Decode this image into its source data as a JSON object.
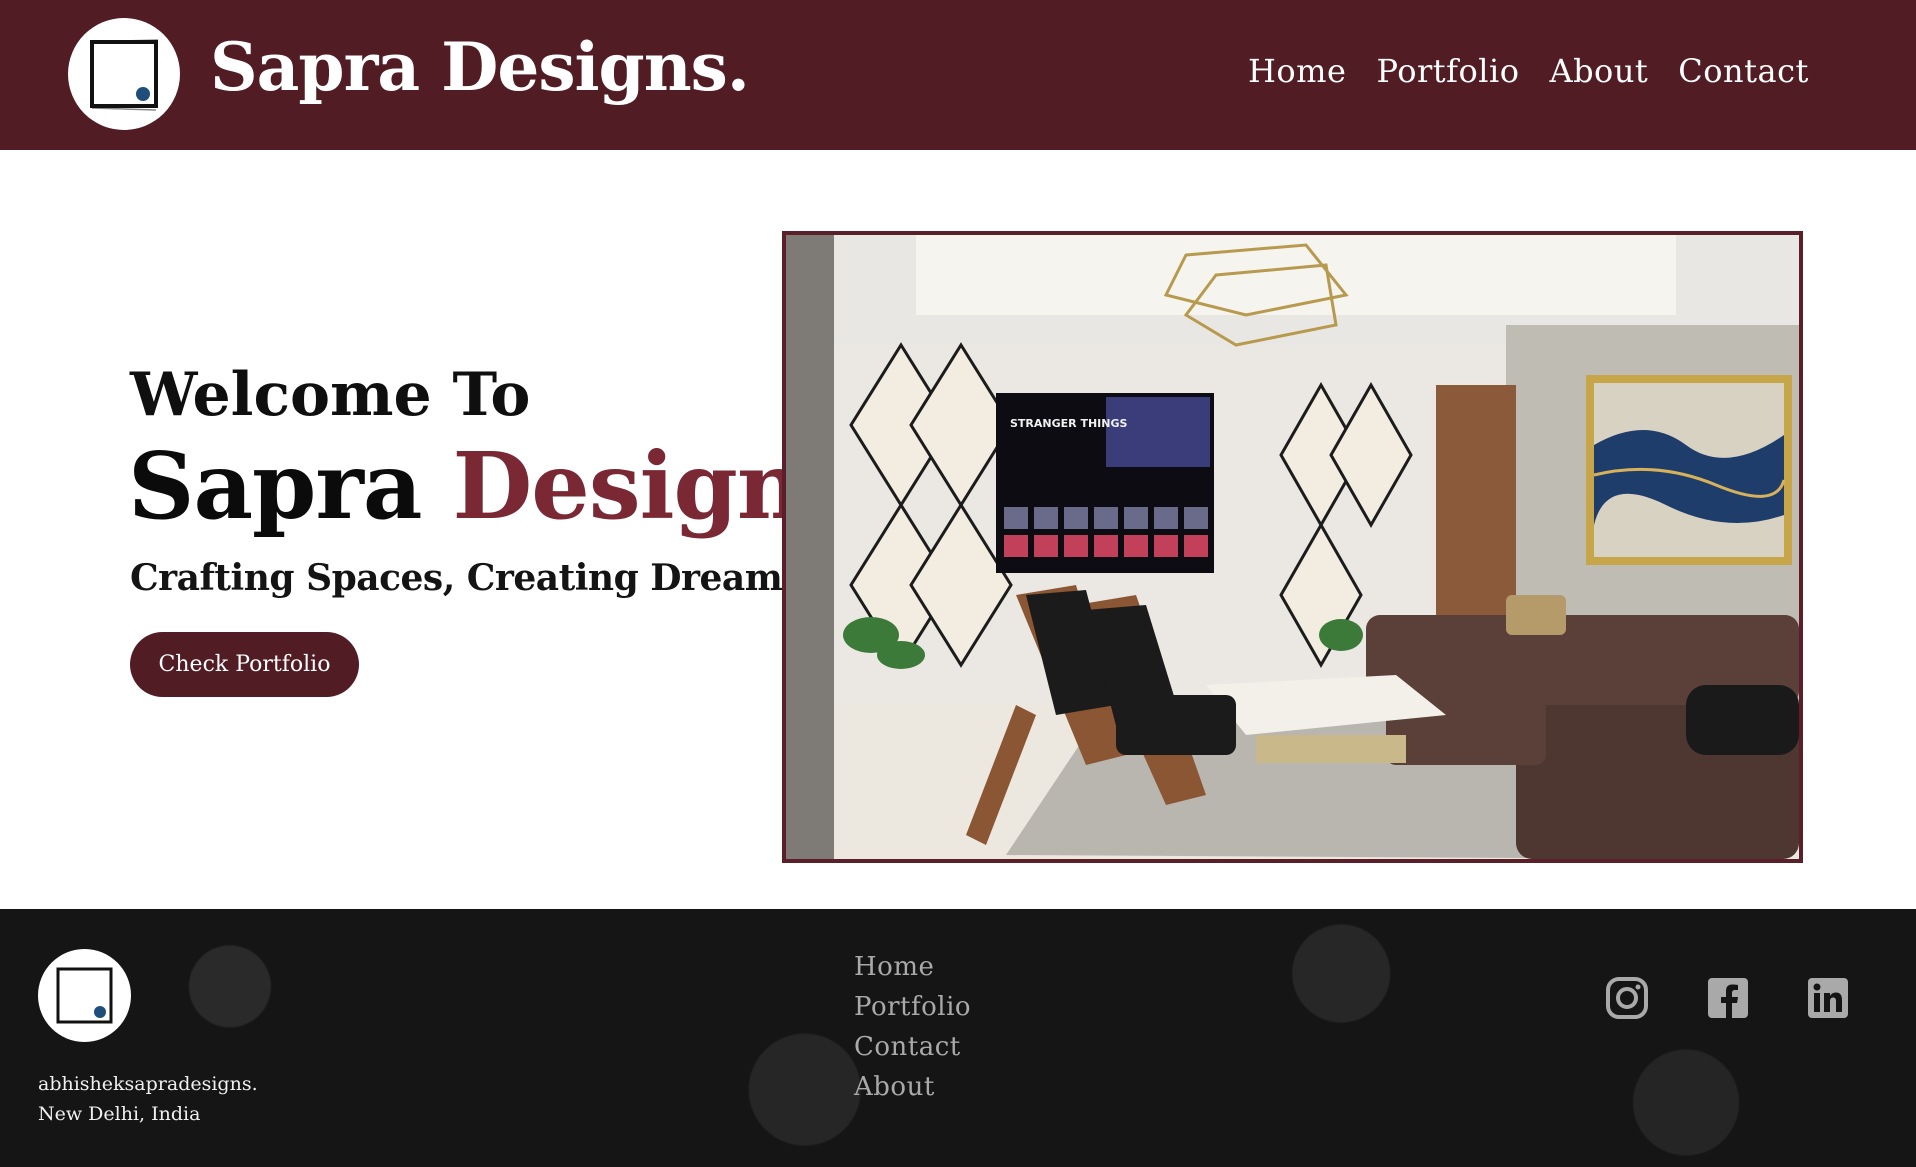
{
  "header": {
    "brand": "Sapra Designs.",
    "nav": [
      "Home",
      "Portfolio",
      "About",
      "Contact"
    ]
  },
  "hero": {
    "welcome": "Welcome To",
    "title_dark": "Sapra",
    "title_accent": "Designs.",
    "tagline": "Crafting Spaces, Creating Dreams",
    "cta": "Check Portfolio",
    "image_screen_tv_title": "STRANGER THINGS"
  },
  "footer": {
    "address_line1": "abhisheksapradesigns.",
    "address_line2": "New Delhi, India",
    "links": [
      "Home",
      "Portfolio",
      "Contact",
      "About"
    ],
    "social": [
      "instagram-icon",
      "facebook-icon",
      "linkedin-icon"
    ]
  },
  "colors": {
    "brand_maroon": "#511c24",
    "accent": "#7a2834",
    "footer_bg": "#151515",
    "logo_dot": "#1f4e7a"
  }
}
